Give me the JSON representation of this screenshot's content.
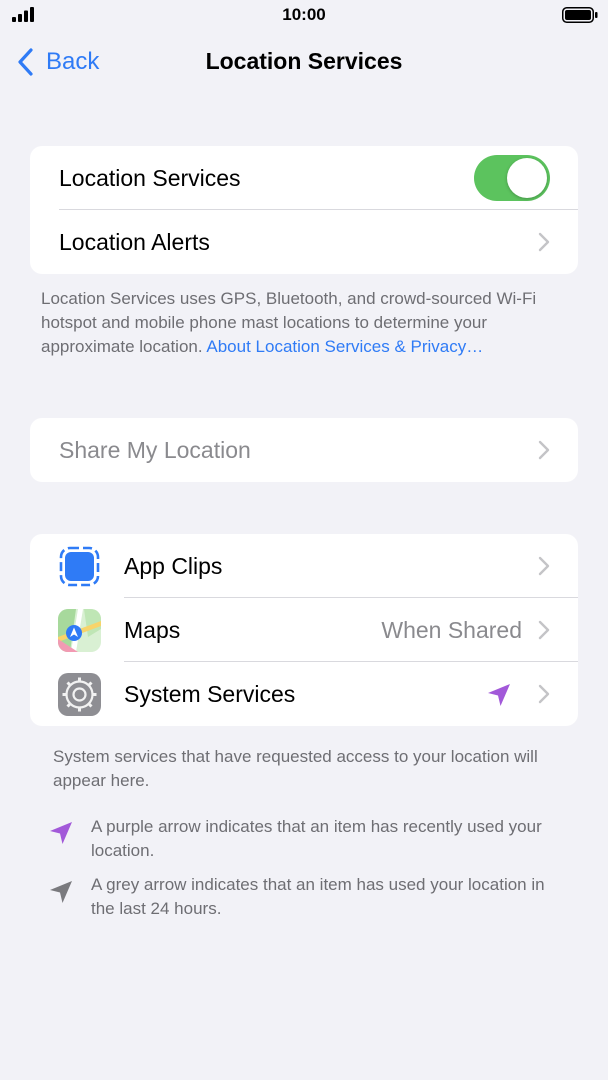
{
  "status_bar": {
    "time": "10:00"
  },
  "nav": {
    "back_label": "Back",
    "title": "Location Services"
  },
  "location_group": {
    "location_services_label": "Location Services",
    "location_services_on": true,
    "location_alerts_label": "Location Alerts"
  },
  "info": {
    "text": "Location Services uses GPS, Bluetooth, and crowd-sourced Wi-Fi hotspot and mobile phone mast locations to determine your approximate location. ",
    "link": "About Location Services & Privacy…"
  },
  "share_row": {
    "label": "Share My Location"
  },
  "apps": [
    {
      "label": "App Clips",
      "icon": "app-clips-icon"
    },
    {
      "label": "Maps",
      "detail": "When Shared",
      "icon": "maps-icon"
    },
    {
      "label": "System Services",
      "icon": "gear-icon",
      "arrow_color": "#a259d9"
    }
  ],
  "footer": {
    "system_note": "System services that have requested access to your location will appear here.",
    "purple_note": "A purple arrow indicates that an item has recently used your location.",
    "grey_note": "A grey arrow indicates that an item has used your location in the last 24 hours."
  },
  "colors": {
    "accent": "#2f7bf6",
    "toggle_on": "#5cc35e",
    "purple_arrow": "#a259d9",
    "grey_arrow": "#8a8a8e"
  }
}
